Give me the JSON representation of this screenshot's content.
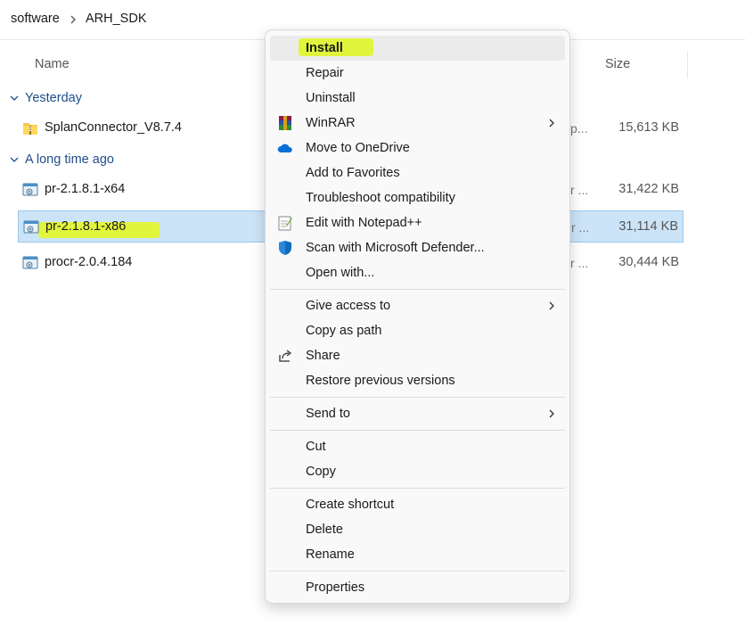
{
  "breadcrumb": {
    "item1": "software",
    "item2": "ARH_SDK"
  },
  "columns": {
    "name": "Name",
    "size": "Size"
  },
  "groups": {
    "yesterday": "Yesterday",
    "long_ago": "A long time ago"
  },
  "files": [
    {
      "name": "SplanConnector_V8.7.4",
      "type_trunc": "p...",
      "size": "15,613 KB"
    },
    {
      "name": "pr-2.1.8.1-x64",
      "type_trunc": "r ...",
      "size": "31,422 KB"
    },
    {
      "name": "pr-2.1.8.1-x86",
      "type_trunc": "r ...",
      "size": "31,114 KB"
    },
    {
      "name": "procr-2.0.4.184",
      "type_trunc": "r ...",
      "size": "30,444 KB"
    }
  ],
  "menu": {
    "install": "Install",
    "repair": "Repair",
    "uninstall": "Uninstall",
    "winrar": "WinRAR",
    "onedrive": "Move to OneDrive",
    "favorites": "Add to Favorites",
    "troubleshoot": "Troubleshoot compatibility",
    "notepad": "Edit with Notepad++",
    "defender": "Scan with Microsoft Defender...",
    "openwith": "Open with...",
    "giveaccess": "Give access to",
    "copypath": "Copy as path",
    "share": "Share",
    "restore": "Restore previous versions",
    "sendto": "Send to",
    "cut": "Cut",
    "copy": "Copy",
    "shortcut": "Create shortcut",
    "delete": "Delete",
    "rename": "Rename",
    "properties": "Properties"
  },
  "colors": {
    "highlight": "#e1f53c",
    "selected_row": "#cce4f7",
    "group_text": "#1f4e8c"
  }
}
